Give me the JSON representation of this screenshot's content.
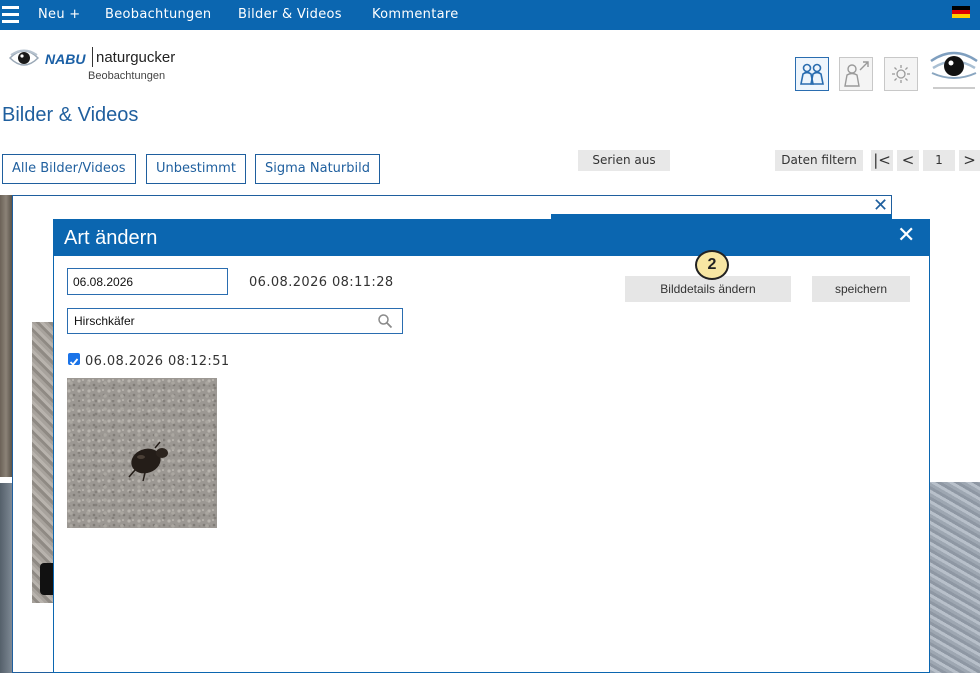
{
  "nav": {
    "new": "Neu +",
    "observations": "Beobachtungen",
    "media": "Bilder & Videos",
    "comments": "Kommentare"
  },
  "brand": {
    "nabu": "NABU",
    "name": "naturgucker",
    "sub": "Beobachtungen"
  },
  "page": {
    "title": "Bilder & Videos"
  },
  "filters": {
    "all": "Alle Bilder/Videos",
    "undetermined": "Unbestimmt",
    "sigma": "Sigma Naturbild",
    "series": "Serien aus",
    "filter_data": "Daten filtern",
    "first": "|<",
    "prev": "<",
    "page": "1",
    "next": ">"
  },
  "modal": {
    "title": "Art ändern",
    "close": "✕",
    "date_value": "06.08.2026",
    "datetime": "06.08.2026 08:11:28",
    "species_value": "Hirschkäfer",
    "details_button": "Bilddetails ändern",
    "save_button": "speichern",
    "step_badge": "2",
    "item_label": "06.08.2026 08:12:51",
    "item_checked": true
  },
  "background": {
    "close": "✕"
  },
  "colors": {
    "primary": "#0b66b0",
    "title": "#1f5f9e"
  }
}
